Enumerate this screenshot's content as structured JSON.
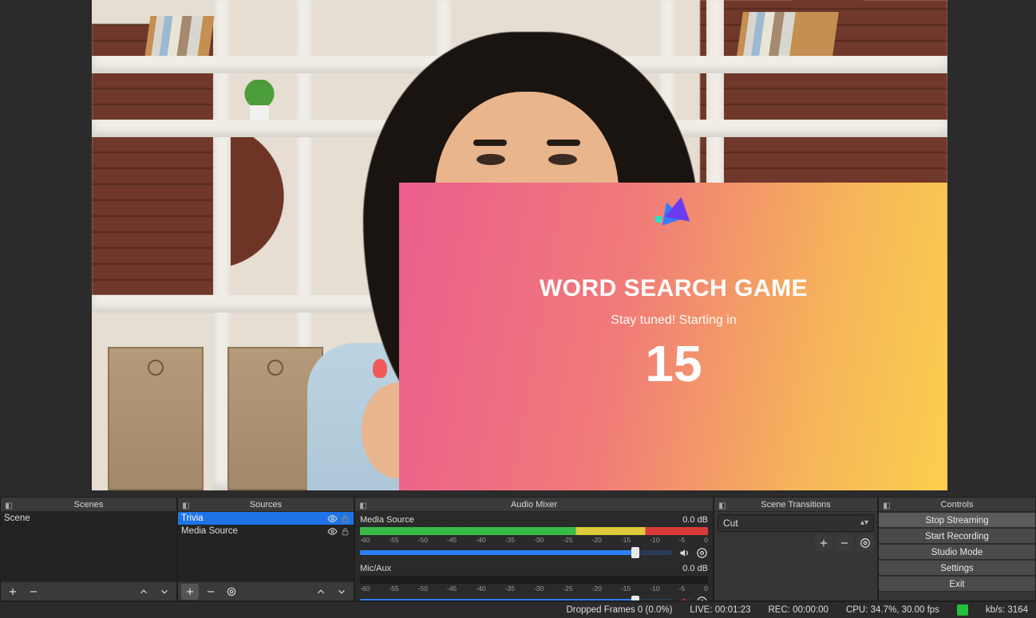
{
  "overlay": {
    "title": "WORD SEARCH GAME",
    "subtitle": "Stay tuned! Starting in",
    "countdown": "15"
  },
  "docks": {
    "scenes": {
      "title": "Scenes",
      "items": [
        "Scene"
      ]
    },
    "sources": {
      "title": "Sources",
      "items": [
        {
          "name": "Trivia",
          "visible": true,
          "locked": false,
          "selected": true
        },
        {
          "name": "Media Source",
          "visible": true,
          "locked": false,
          "selected": false
        }
      ]
    },
    "mixer": {
      "title": "Audio Mixer",
      "ticks": [
        "-60",
        "-55",
        "-50",
        "-45",
        "-40",
        "-35",
        "-30",
        "-25",
        "-20",
        "-15",
        "-10",
        "-5",
        "0"
      ],
      "channels": [
        {
          "name": "Media Source",
          "db": "0.0 dB",
          "vol_pct": 88,
          "muted": false
        },
        {
          "name": "Mic/Aux",
          "db": "0.0 dB",
          "vol_pct": 88,
          "muted": true
        }
      ]
    },
    "transitions": {
      "title": "Scene Transitions",
      "selected": "Cut"
    },
    "controls": {
      "title": "Controls",
      "buttons": {
        "stop_streaming": "Stop Streaming",
        "start_recording": "Start Recording",
        "studio_mode": "Studio Mode",
        "settings": "Settings",
        "exit": "Exit"
      }
    }
  },
  "status": {
    "dropped": "Dropped Frames 0 (0.0%)",
    "live": "LIVE: 00:01:23",
    "rec": "REC: 00:00:00",
    "cpu": "CPU: 34.7%, 30.00 fps",
    "kbps": "kb/s: 3164"
  }
}
